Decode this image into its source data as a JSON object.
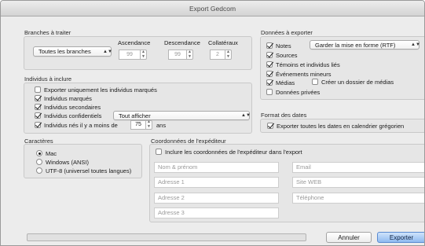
{
  "window": {
    "title": "Export Gedcom"
  },
  "branches": {
    "title": "Branches à traiter",
    "select_value": "Toutes les branches",
    "col_ascendance": "Ascendance",
    "col_descendance": "Descendance",
    "col_collateraux": "Collatéraux",
    "ascendance_value": "99",
    "descendance_value": "99",
    "collateraux_value": "2"
  },
  "individus": {
    "title": "Individus à inclure",
    "items": [
      {
        "label": "Exporter uniquement les individus marqués",
        "checked": false
      },
      {
        "label": "Individus marqués",
        "checked": true
      },
      {
        "label": "Individus secondaires",
        "checked": true
      },
      {
        "label": "Individus confidentiels",
        "checked": true
      },
      {
        "label": "Individus nés il y a moins de",
        "checked": true
      }
    ],
    "confidentiels_select": "Tout afficher",
    "years_value": "75",
    "years_unit": "ans"
  },
  "donnees": {
    "title": "Données à exporter",
    "notes_label": "Notes",
    "notes_checked": true,
    "notes_select": "Garder la mise en forme (RTF)",
    "items": [
      {
        "label": "Sources",
        "checked": true
      },
      {
        "label": "Témoins et individus liés",
        "checked": true
      },
      {
        "label": "Événements mineurs",
        "checked": true
      },
      {
        "label": "Médias",
        "checked": true
      },
      {
        "label": "Données privées",
        "checked": false
      }
    ],
    "media_folder_label": "Créer un dossier de médias",
    "media_folder_checked": false
  },
  "format_dates": {
    "title": "Format des dates",
    "label": "Exporter toutes les dates en calendrier grégorien",
    "checked": true
  },
  "caracteres": {
    "title": "Caractères",
    "options": [
      {
        "label": "Mac",
        "selected": true
      },
      {
        "label": "Windows (ANSI)",
        "selected": false
      },
      {
        "label": "UTF-8 (universel toutes langues)",
        "selected": false
      }
    ]
  },
  "expediteur": {
    "title": "Coordonnées de l'expéditeur",
    "include_label": "Inclure les coordonnées de l'expéditeur dans l'export",
    "include_checked": false,
    "placeholders": {
      "name": "Nom & prénom",
      "email": "Email",
      "address1": "Adresse 1",
      "website": "Site WEB",
      "address2": "Adresse 2",
      "phone": "Téléphone",
      "address3": "Adresse 3"
    }
  },
  "footer": {
    "progress_fraction": 0,
    "cancel_label": "Annuler",
    "export_label": "Exporter"
  },
  "colors": {
    "accent": "#8fbaf0",
    "window_bg": "#ececec",
    "group_bg": "#e6e6e6"
  },
  "icons": {
    "checkmark": "checkmark-icon",
    "select_arrow": "select-arrows-icon",
    "stepper": "stepper-arrows-icon"
  }
}
